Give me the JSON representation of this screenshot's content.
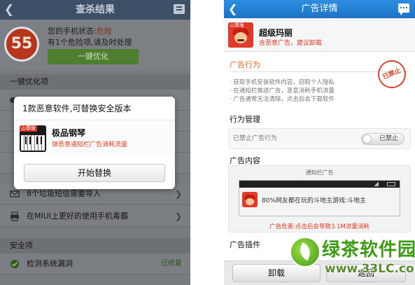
{
  "left": {
    "title": "查杀结果",
    "score": "55",
    "status_prefix": "您的手机状态:",
    "status_value": "危险",
    "risk_text": "有1个危险项,请及时处理",
    "optimize_button": "一键优化",
    "section_optimize": "一键优化项",
    "rows": [
      {
        "text": "8个垃圾短信需要导入"
      },
      {
        "text": "在MIUI上更好的使用手机毒霸"
      }
    ],
    "section_safe": "安全项",
    "safe_row": {
      "text": "检测系统漏洞",
      "status": "已修复"
    },
    "dialog": {
      "title": "1款恶意软件,可替换安全版本",
      "badge": "山寨版",
      "app_name": "极品钢琴",
      "app_warning": "弹恶意通知栏广告消耗流量",
      "button": "开始替换"
    }
  },
  "right": {
    "title": "广告详情",
    "badge": "山寨版",
    "app_name": "超级玛丽",
    "app_warning": "含恶意广告，建议卸载",
    "ad_behavior_title": "广告行为",
    "ad_behaviors": [
      "· 获取手机安装软件内容，窃取个人隐私",
      "· 在通知栏推送广告，恶意消耗手机流量",
      "· 广告通常无法清除，点击后会下载软件"
    ],
    "stamp": "已禁止",
    "mgmt_title": "行为管理",
    "mgmt_label": "已禁止广告行为",
    "toggle_label": "已禁止",
    "content_title": "广告内容",
    "notif_title": "通知栏广告",
    "notif_text": "80%网友都在玩的斗地主游戏:斗地主",
    "hazard": "广告危害:点击后会导致3.1M流量消耗",
    "plugin_title": "广告插件",
    "uninstall": "卸载",
    "back": "返回"
  },
  "watermark": {
    "name": "绿茶软件园",
    "url": "www.33LC.com"
  },
  "icons": {
    "back": "back-arrow-icon",
    "menu": "menu-icon",
    "chat": "chat-bubble-icon",
    "check": "check-circle-icon"
  },
  "colors": {
    "left_topbar": "#3d4f67",
    "score_red": "#b5361a",
    "optimize_green": "#4e7f2e",
    "right_topbar": "#1d74c6",
    "warning_red": "#e3391f",
    "section_orange": "#e86a1c",
    "watermark_green": "#3d9a13"
  }
}
